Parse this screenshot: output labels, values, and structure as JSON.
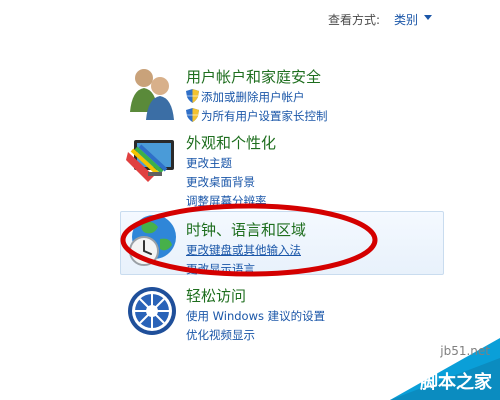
{
  "header": {
    "view_by_label": "查看方式:",
    "view_by_value": "类别"
  },
  "categories": [
    {
      "title": "用户帐户和家庭安全",
      "icon": "users-icon",
      "links": [
        "添加或删除用户帐户",
        "为所有用户设置家长控制"
      ]
    },
    {
      "title": "外观和个性化",
      "icon": "monitor-paint-icon",
      "links": [
        "更改主题",
        "更改桌面背景",
        "调整屏幕分辨率"
      ]
    },
    {
      "title": "时钟、语言和区域",
      "icon": "globe-clock-icon",
      "links": [
        "更改键盘或其他输入法",
        "更改显示语言"
      ]
    },
    {
      "title": "轻松访问",
      "icon": "ease-of-access-icon",
      "links": [
        "使用 Windows 建议的设置",
        "优化视频显示"
      ]
    }
  ],
  "watermark": {
    "site": "jb51.net",
    "name": "脚本之家"
  },
  "colors": {
    "title_green": "#1e6e1e",
    "link_blue": "#1a56a8",
    "annotation_red": "#d40000"
  }
}
